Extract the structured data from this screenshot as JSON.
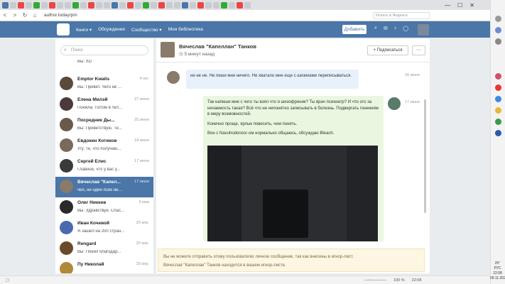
{
  "browser": {
    "url": "author.today/pm",
    "search_placeholder": "Искать в Яндексе",
    "zoom": "100 %",
    "time_bottom": "22:08",
    "window_minimize": "—",
    "window_maximize": "☐",
    "window_close": "✕"
  },
  "tray": {
    "weather": "25°",
    "lang": "РУС",
    "time": "22:08",
    "date": "09.11.2023"
  },
  "site": {
    "nav": [
      "Книги ▾",
      "Обсуждения",
      "Сообщество ▾",
      "Моя библиотека"
    ],
    "add_button": "Добавить"
  },
  "sidebar": {
    "search_placeholder": "Поиск",
    "contacts": [
      {
        "name": "",
        "date": "",
        "preview": "Вы: XD"
      },
      {
        "name": "Emptor Kwalis",
        "date": "4 окт.",
        "preview": "Вы: Привет. Чего не ..."
      },
      {
        "name": "Елена Милэй",
        "date": "27 июня",
        "preview": "Поняла. Потом в тел..."
      },
      {
        "name": "Посредник Ды...",
        "date": "25 июня",
        "preview": "Вы: Приветствую. Те..."
      },
      {
        "name": "Евдокин Котиков",
        "date": "18 июня",
        "preview": "Угу. Те, что получаю..."
      },
      {
        "name": "Сергей Елис",
        "date": "17 июня",
        "preview": "Главное, что у вас у..."
      },
      {
        "name": "Вячеслав \"Капел...",
        "date": "17 июня",
        "preview": "чел, ни один псих не..."
      },
      {
        "name": "Олег Никеев",
        "date": "5 мая",
        "preview": "Вы: Здравствуй. Спас..."
      },
      {
        "name": "Иван Кочевой",
        "date": "20 апр.",
        "preview": "Я зашёл на 200 стран..."
      },
      {
        "name": "Rengard",
        "date": "20 апр.",
        "preview": "Вы: Понял благодар..."
      },
      {
        "name": "Пу Николай",
        "date": "20 апр.",
        "preview": ""
      }
    ]
  },
  "chat": {
    "name": "Вячеслав \"Капеллан\" Танков",
    "status": "5 минут назад",
    "subscribe_label": "+ Подписаться",
    "more_label": "···",
    "messages": [
      {
        "date": "16 июня",
        "text": "не не не. Не пиши мне ничего. Не хватало мне еще с шизиками переписываться."
      },
      {
        "date": "17 июня",
        "paragraphs": [
          "Так напиши мне с чего ты взял что я шизофреник? Ты врач психиатр? И что это за нечаемость такая? Всё что не непонятно записывать в болезнь. Подвергать гонениям в меру возможностей.",
          "Конечно проще, ярлык повесить, чем понять.",
          "Вон с Navuhodonosr-ом нормально общаюсь, обсуждаю Bleach."
        ]
      }
    ],
    "warning_line1": "Вы не можете отправить этому пользователю личное сообщение, так как внесены в игнор-лист.",
    "warning_line2": "Вячеслав \"Капеллан\" Танков находится в вашем игнор-листе."
  }
}
